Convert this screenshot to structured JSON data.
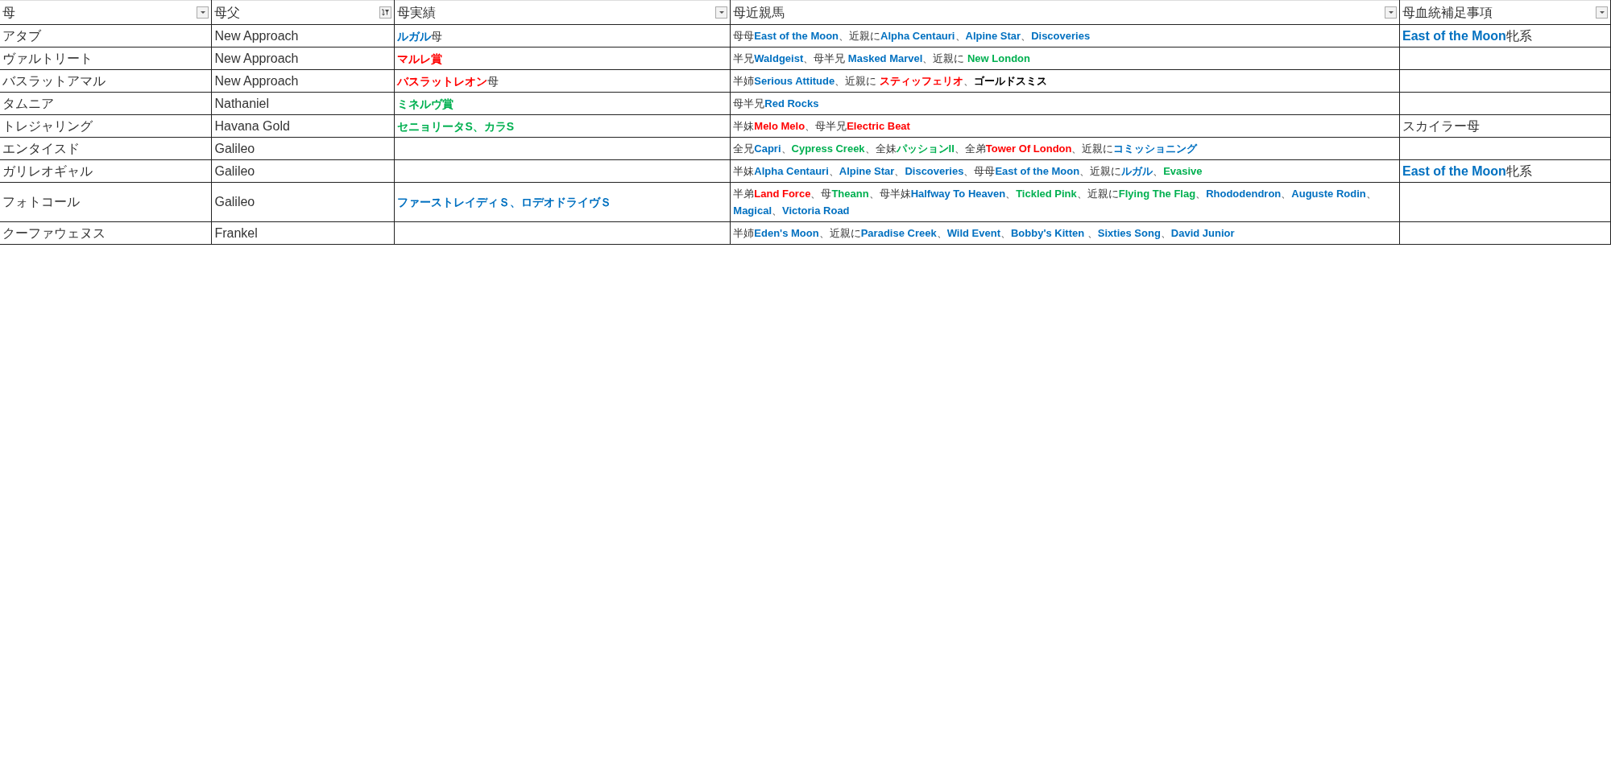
{
  "table": {
    "columns": [
      {
        "label": "母",
        "filtered": false
      },
      {
        "label": "母父",
        "filtered": true
      },
      {
        "label": "母実績",
        "filtered": false
      },
      {
        "label": "母近親馬",
        "filtered": false
      },
      {
        "label": "母血統補足事項",
        "filtered": false
      }
    ],
    "rows": [
      {
        "mother": "アタブ",
        "sire": "New Approach",
        "record": [
          {
            "text": "ルガル",
            "color": "#0070c0"
          },
          {
            "text": "母"
          }
        ],
        "relatives": [
          {
            "text": "母母"
          },
          {
            "text": "East of the Moon",
            "color": "#0070c0"
          },
          {
            "text": "、近親に"
          },
          {
            "text": "Alpha Centauri",
            "color": "#0070c0"
          },
          {
            "text": "、"
          },
          {
            "text": "Alpine Star",
            "color": "#0070c0"
          },
          {
            "text": "、"
          },
          {
            "text": "Discoveries",
            "color": "#0070c0"
          }
        ],
        "note": [
          {
            "text": "East of the Moon",
            "color": "#0070c0"
          },
          {
            "text": "牝系"
          }
        ]
      },
      {
        "mother": "ヴァルトリート",
        "sire": "New Approach",
        "record": [
          {
            "text": "マルレ賞",
            "color": "#ff0000"
          }
        ],
        "relatives": [
          {
            "text": "半兄"
          },
          {
            "text": "Waldgeist",
            "color": "#0070c0"
          },
          {
            "text": "、母半兄 "
          },
          {
            "text": "Masked Marvel",
            "color": "#0070c0"
          },
          {
            "text": "、近親に "
          },
          {
            "text": "New London",
            "color": "#00b050"
          }
        ],
        "note": []
      },
      {
        "mother": "バスラットアマル",
        "sire": "New Approach",
        "record": [
          {
            "text": "バスラットレオン",
            "color": "#ff0000"
          },
          {
            "text": "母"
          }
        ],
        "relatives": [
          {
            "text": "半姉"
          },
          {
            "text": "Serious Attitude",
            "color": "#0070c0"
          },
          {
            "text": "、近親に "
          },
          {
            "text": "スティッフェリオ",
            "color": "#ff0000"
          },
          {
            "text": "、"
          },
          {
            "text": "ゴールドスミス",
            "color": "#000000"
          }
        ],
        "note": []
      },
      {
        "mother": "タムニア",
        "sire": "Nathaniel",
        "record": [
          {
            "text": "ミネルヴ賞",
            "color": "#00b050"
          }
        ],
        "relatives": [
          {
            "text": "母半兄"
          },
          {
            "text": "Red Rocks",
            "color": "#0070c0"
          }
        ],
        "note": []
      },
      {
        "mother": "トレジャリング",
        "sire": "Havana Gold",
        "record": [
          {
            "text": "セニョリータS、カラS",
            "color": "#00b050"
          }
        ],
        "relatives": [
          {
            "text": "半妹"
          },
          {
            "text": "Melo Melo",
            "color": "#ff0000"
          },
          {
            "text": "、母半兄"
          },
          {
            "text": "Electric Beat",
            "color": "#ff0000"
          }
        ],
        "note": [
          {
            "text": "スカイラー母"
          }
        ]
      },
      {
        "mother": "エンタイスド",
        "sire": "Galileo",
        "record": [],
        "relatives": [
          {
            "text": "全兄"
          },
          {
            "text": "Capri",
            "color": "#0070c0"
          },
          {
            "text": "、"
          },
          {
            "text": "Cypress Creek",
            "color": "#00b050"
          },
          {
            "text": "、全妹"
          },
          {
            "text": "パッションII",
            "color": "#00b050"
          },
          {
            "text": "、全弟"
          },
          {
            "text": "Tower Of London",
            "color": "#ff0000"
          },
          {
            "text": "、近親に"
          },
          {
            "text": "コミッショニング",
            "color": "#0070c0"
          }
        ],
        "note": []
      },
      {
        "mother": "ガリレオギャル",
        "sire": "Galileo",
        "record": [],
        "relatives": [
          {
            "text": "半妹"
          },
          {
            "text": "Alpha Centauri",
            "color": "#0070c0"
          },
          {
            "text": "、"
          },
          {
            "text": "Alpine Star",
            "color": "#0070c0"
          },
          {
            "text": "、"
          },
          {
            "text": "Discoveries",
            "color": "#0070c0"
          },
          {
            "text": "、母母"
          },
          {
            "text": "East of the Moon",
            "color": "#0070c0"
          },
          {
            "text": "、近親に"
          },
          {
            "text": "ルガル",
            "color": "#0070c0"
          },
          {
            "text": "、"
          },
          {
            "text": "Evasive",
            "color": "#00b050"
          }
        ],
        "note": [
          {
            "text": "East of the Moon",
            "color": "#0070c0"
          },
          {
            "text": "牝系"
          }
        ]
      },
      {
        "mother": "フォトコール",
        "sire": "Galileo",
        "record": [
          {
            "text": "ファーストレイディＳ、ロデオドライヴＳ",
            "color": "#0070c0"
          }
        ],
        "relatives": [
          {
            "text": "半弟"
          },
          {
            "text": "Land Force",
            "color": "#ff0000"
          },
          {
            "text": "、母"
          },
          {
            "text": "Theann",
            "color": "#00b050"
          },
          {
            "text": "、母半妹"
          },
          {
            "text": "Halfway To Heaven",
            "color": "#0070c0"
          },
          {
            "text": "、"
          },
          {
            "text": "Tickled Pink",
            "color": "#00b050"
          },
          {
            "text": "、近親に"
          },
          {
            "text": "Flying The Flag",
            "color": "#00b050"
          },
          {
            "text": "、"
          },
          {
            "text": "Rhododendron",
            "color": "#0070c0"
          },
          {
            "text": "、"
          },
          {
            "text": "Auguste Rodin",
            "color": "#0070c0"
          },
          {
            "text": "、"
          },
          {
            "text": "Magical",
            "color": "#0070c0"
          },
          {
            "text": "、"
          },
          {
            "text": "Victoria Road",
            "color": "#0070c0"
          }
        ],
        "note": []
      },
      {
        "mother": "クーファウェヌス",
        "sire": "Frankel",
        "record": [],
        "relatives": [
          {
            "text": "半姉"
          },
          {
            "text": "Eden's Moon",
            "color": "#0070c0"
          },
          {
            "text": "、近親に"
          },
          {
            "text": "Paradise Creek",
            "color": "#0070c0"
          },
          {
            "text": "、"
          },
          {
            "text": "Wild Event",
            "color": "#0070c0"
          },
          {
            "text": "、"
          },
          {
            "text": "Bobby's Kitten ",
            "color": "#0070c0"
          },
          {
            "text": "、"
          },
          {
            "text": "Sixties Song",
            "color": "#0070c0"
          },
          {
            "text": "、"
          },
          {
            "text": "David Junior",
            "color": "#0070c0"
          }
        ],
        "note": []
      }
    ]
  }
}
